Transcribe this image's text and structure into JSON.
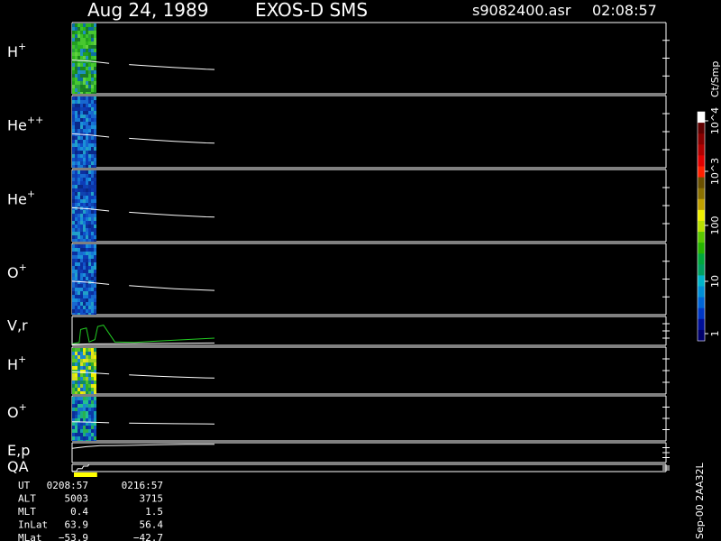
{
  "header": {
    "date": "Aug 24, 1989",
    "mission": "EXOS-D SMS",
    "file": "s9082400.asr",
    "time": "02:08:57"
  },
  "footer_right": "Sep-00 2AA32L",
  "colorbar": {
    "unit": "Ct/Smp",
    "tick_labels": [
      "1",
      "10",
      "100",
      "10^3",
      "10^4"
    ],
    "colors": [
      "#00006b",
      "#000f96",
      "#0037c4",
      "#0065d6",
      "#008fd6",
      "#00b5c9",
      "#00a060",
      "#00a83c",
      "#26b400",
      "#5ac800",
      "#b8e000",
      "#f0f000",
      "#c0a000",
      "#8a7000",
      "#6a5000",
      "#ff2000",
      "#e00000",
      "#b00000",
      "#880000",
      "#600000",
      "#ffffff"
    ]
  },
  "colors": {
    "axis": "#ffffff",
    "line": "#ffffff",
    "velocity_line": "#22cc22",
    "qa_bar": "#ffff00"
  },
  "chart_data": [
    {
      "type": "heatmap",
      "label_base": "H",
      "label_sup": "+",
      "y_top": "180",
      "y_bottom": "−180",
      "palette": "green",
      "trace": [
        [
          0.0,
          -0.18
        ],
        [
          0.12,
          -0.28
        ],
        [
          0.26,
          -0.48
        ],
        [
          0.4,
          -0.6
        ],
        [
          0.58,
          -0.76
        ],
        [
          0.72,
          -0.88
        ],
        [
          0.94,
          -1.04
        ],
        [
          1.0,
          -1.06
        ]
      ]
    },
    {
      "type": "heatmap",
      "label_base": "He",
      "label_sup": "++",
      "y_top": "180",
      "y_bottom": "−180",
      "palette": "blue",
      "trace": [
        [
          0.0,
          -0.2
        ],
        [
          0.12,
          -0.3
        ],
        [
          0.26,
          -0.5
        ],
        [
          0.4,
          -0.62
        ],
        [
          0.58,
          -0.78
        ],
        [
          0.72,
          -0.9
        ],
        [
          0.94,
          -1.04
        ],
        [
          1.0,
          -1.06
        ]
      ]
    },
    {
      "type": "heatmap",
      "label_base": "He",
      "label_sup": "+",
      "y_top": "180",
      "y_bottom": "−180",
      "palette": "blue",
      "trace": [
        [
          0.0,
          -0.2
        ],
        [
          0.12,
          -0.3
        ],
        [
          0.26,
          -0.5
        ],
        [
          0.4,
          -0.62
        ],
        [
          0.58,
          -0.78
        ],
        [
          0.72,
          -0.9
        ],
        [
          0.94,
          -1.04
        ],
        [
          1.0,
          -1.06
        ]
      ]
    },
    {
      "type": "heatmap",
      "label_base": "O",
      "label_sup": "+",
      "y_top": "180",
      "y_bottom": "−180",
      "palette": "blue",
      "trace": [
        [
          0.0,
          -0.2
        ],
        [
          0.12,
          -0.3
        ],
        [
          0.26,
          -0.5
        ],
        [
          0.4,
          -0.62
        ],
        [
          0.58,
          -0.78
        ],
        [
          0.72,
          -0.9
        ],
        [
          0.94,
          -1.04
        ],
        [
          1.0,
          -1.06
        ]
      ]
    },
    {
      "type": "line",
      "label_base": "V,r",
      "label_sup": "",
      "y_top": "25",
      "y_bottom": "0",
      "right_top": "90",
      "right_bottom": "0",
      "series": [
        {
          "color": "green",
          "points": [
            [
              0.0,
              0.05
            ],
            [
              0.05,
              0.1
            ],
            [
              0.06,
              0.55
            ],
            [
              0.1,
              0.6
            ],
            [
              0.12,
              0.12
            ],
            [
              0.16,
              0.2
            ],
            [
              0.18,
              0.65
            ],
            [
              0.22,
              0.7
            ],
            [
              0.3,
              0.12
            ],
            [
              0.44,
              0.1
            ],
            [
              0.6,
              0.15
            ],
            [
              0.8,
              0.2
            ],
            [
              1.0,
              0.25
            ]
          ]
        },
        {
          "color": "white",
          "points": [
            [
              0.0,
              0.03
            ],
            [
              0.12,
              0.05
            ],
            [
              0.4,
              0.06
            ],
            [
              1.0,
              0.08
            ]
          ]
        }
      ]
    },
    {
      "type": "heatmap",
      "label_base": "H",
      "label_sup": "+",
      "y_top": "180",
      "y_bottom": "−180",
      "palette": "mixed",
      "trace": [
        [
          0.0,
          -0.18
        ],
        [
          0.12,
          -0.28
        ],
        [
          0.26,
          -0.48
        ],
        [
          0.4,
          -0.62
        ],
        [
          0.58,
          -0.78
        ],
        [
          0.72,
          -0.9
        ],
        [
          0.94,
          -1.04
        ],
        [
          1.0,
          -1.06
        ]
      ]
    },
    {
      "type": "heatmap",
      "label_base": "O",
      "label_sup": "+",
      "y_top": "180",
      "y_bottom": "−180",
      "palette": "teal",
      "trace": [
        [
          0.0,
          -0.5
        ],
        [
          0.12,
          -0.55
        ],
        [
          0.26,
          -0.65
        ],
        [
          0.4,
          -0.7
        ],
        [
          0.58,
          -0.74
        ],
        [
          0.72,
          -0.78
        ],
        [
          0.94,
          -0.82
        ],
        [
          1.0,
          -0.83
        ]
      ]
    },
    {
      "type": "line",
      "label_base": "E,p",
      "label_sup": "",
      "y_top": "4000",
      "y_bottom": "",
      "right_top": "90",
      "right_bottom": "",
      "series": [
        {
          "color": "white",
          "points": [
            [
              0.0,
              0.72
            ],
            [
              0.1,
              0.8
            ],
            [
              0.2,
              0.85
            ],
            [
              0.4,
              0.87
            ],
            [
              0.6,
              0.9
            ],
            [
              0.8,
              0.92
            ],
            [
              1.0,
              0.92
            ]
          ]
        }
      ]
    },
    {
      "type": "line",
      "label_base": "QA",
      "label_sup": "",
      "y_top": "",
      "y_bottom": "0",
      "right_top": "",
      "right_bottom": "0",
      "series": [
        {
          "color": "white",
          "points": [
            [
              0.0,
              0.05
            ],
            [
              0.03,
              0.05
            ],
            [
              0.04,
              0.4
            ],
            [
              0.07,
              0.4
            ],
            [
              0.08,
              0.75
            ],
            [
              0.11,
              0.75
            ],
            [
              0.12,
              1.0
            ],
            [
              0.15,
              1.0
            ]
          ]
        }
      ],
      "bar": {
        "x_start": 0.0,
        "x_end": 0.1,
        "color": "yellow"
      }
    }
  ],
  "info_table": {
    "rows": [
      {
        "label": "UT",
        "v1": "0208:57",
        "v2": "0216:57"
      },
      {
        "label": "ALT",
        "v1": "5003",
        "v2": "3715"
      },
      {
        "label": "MLT",
        "v1": "0.4",
        "v2": "1.5"
      },
      {
        "label": "InLat",
        "v1": "63.9",
        "v2": "56.4"
      },
      {
        "label": "MLat",
        "v1": "−53.9",
        "v2": "−42.7"
      }
    ]
  }
}
